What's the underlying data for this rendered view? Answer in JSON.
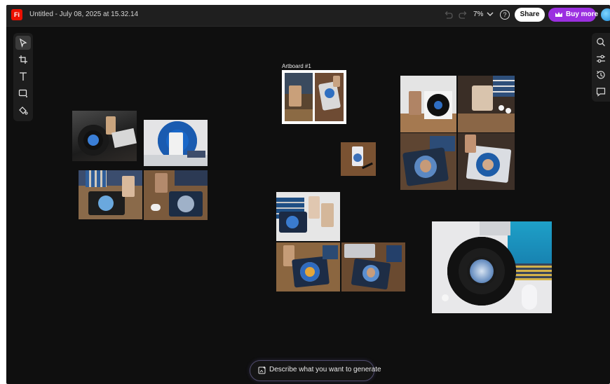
{
  "app": {
    "logo_text": "Fi",
    "document_title": "Untitled - July 08, 2025 at 15.32.14",
    "zoom": "7%",
    "help_symbol": "?",
    "share_label": "Share",
    "buy_more_label": "Buy more"
  },
  "left_tools": [
    {
      "name": "select-tool",
      "icon": "pointer-icon",
      "active": true
    },
    {
      "name": "artboard-tool",
      "icon": "artboard-icon",
      "active": false
    },
    {
      "name": "text-tool",
      "icon": "text-icon",
      "active": false
    },
    {
      "name": "shape-tool",
      "icon": "rectangle-icon",
      "active": false
    },
    {
      "name": "fill-tool",
      "icon": "paint-bucket-icon",
      "active": false
    }
  ],
  "right_tools": [
    {
      "name": "search-tool",
      "icon": "search-icon"
    },
    {
      "name": "adjustments-tool",
      "icon": "sliders-icon"
    },
    {
      "name": "history-tool",
      "icon": "history-icon"
    },
    {
      "name": "comments-tool",
      "icon": "comment-icon"
    }
  ],
  "canvas": {
    "artboard_label": "Artboard #1"
  },
  "prompt_bar": {
    "placeholder": "Describe what you want to generate"
  },
  "colors": {
    "background": "#0f0f0f",
    "topbar": "#1f1f1f",
    "logo": "#eb1000",
    "buy_more": "#9b2fe0",
    "share_button": "#ffffff"
  }
}
